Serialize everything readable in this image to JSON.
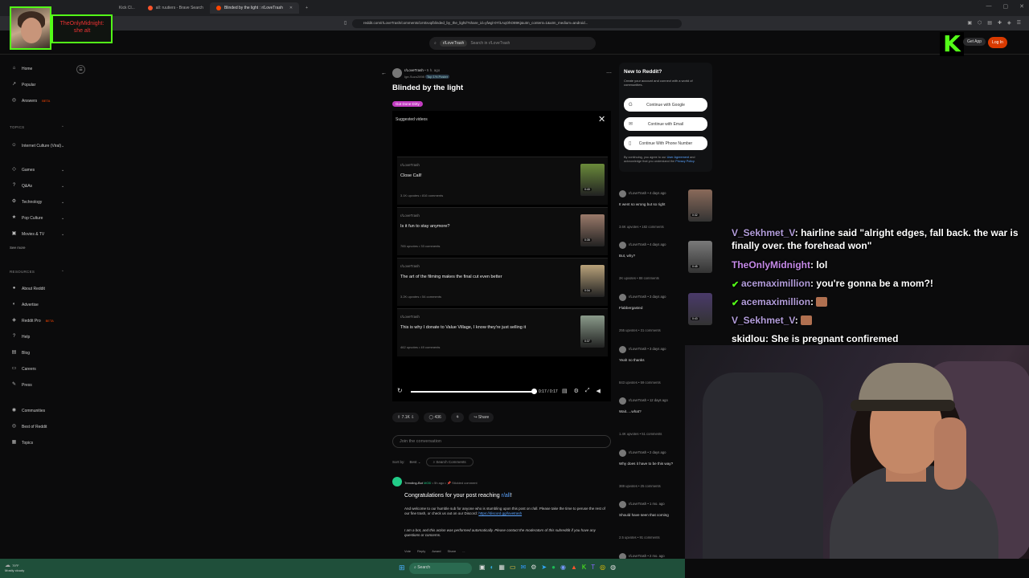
{
  "browser": {
    "tabs": [
      {
        "label": "Kick Cl..."
      },
      {
        "label": "all: ruutiers - Brave Search"
      },
      {
        "label": "Blinded by the light : r/LoveTrash",
        "active": true
      }
    ],
    "url": "reddit.com/r/LoveTrash/comments/1m0xvq/blinded_by_the_light/?share_id=yfwgl-0Yl1AqOhO89Kj&utm_content=1&utm_medium=android..."
  },
  "streamer_cam": {
    "name": "TheOnlyMidnight: she alt"
  },
  "header": {
    "search_chip": "r/LoveTrash",
    "search_placeholder": "Search in r/LoveTrash",
    "get_app": "Get App",
    "login": "Log In",
    "kick_logo": "K"
  },
  "sidebar": {
    "items_top": [
      {
        "label": "Home",
        "icon": "home-icon",
        "glyph": "⌂"
      },
      {
        "label": "Popular",
        "icon": "popular-icon",
        "glyph": "↗"
      },
      {
        "label": "Answers",
        "icon": "answers-icon",
        "glyph": "◎",
        "badge": "BETA"
      }
    ],
    "topics_head": "TOPICS",
    "topics": [
      {
        "label": "Internet Culture (Viral)",
        "glyph": "☺"
      },
      {
        "label": "Games",
        "glyph": "◇"
      },
      {
        "label": "Q&As",
        "glyph": "?"
      },
      {
        "label": "Technology",
        "glyph": "⚙"
      },
      {
        "label": "Pop Culture",
        "glyph": "★"
      },
      {
        "label": "Movies & TV",
        "glyph": "▣"
      }
    ],
    "see_more": "See more",
    "resources_head": "RESOURCES",
    "resources": [
      {
        "label": "About Reddit",
        "glyph": "●"
      },
      {
        "label": "Advertise",
        "glyph": "◐"
      },
      {
        "label": "Reddit Pro",
        "glyph": "◈",
        "badge": "BETA"
      },
      {
        "label": "Help",
        "glyph": "?"
      },
      {
        "label": "Blog",
        "glyph": "▤"
      },
      {
        "label": "Careers",
        "glyph": "▭"
      },
      {
        "label": "Press",
        "glyph": "✎"
      }
    ],
    "bottom": [
      {
        "label": "Communities",
        "glyph": "◉"
      },
      {
        "label": "Best of Reddit",
        "glyph": "◎"
      },
      {
        "label": "Topics",
        "glyph": "▦"
      }
    ]
  },
  "post": {
    "subreddit": "r/LoveTrash",
    "time": "• 5 h. ago",
    "username": "Ige-Suzo2898",
    "user_flair": "Top 1% Poster",
    "title": "Blinded by the light",
    "flair": "Got Done Dirty"
  },
  "video": {
    "label": "Suggested videos",
    "suggestions": [
      {
        "sub": "r/LoveTrash",
        "title": "Close Call!",
        "meta": "3.1K upvotes • 816 comments",
        "duration": "0:40",
        "color": "#6a8a3a"
      },
      {
        "sub": "r/LoveTrash",
        "title": "Is it fun to stay anymore?",
        "meta": "765 upvotes • 33 comments",
        "duration": "0:35",
        "color": "#9a7a6a"
      },
      {
        "sub": "r/LoveTrash",
        "title": "The art of the filming makes the final cut even better",
        "meta": "3.2K upvotes • 54 comments",
        "duration": "0:34",
        "color": "#b9a27a"
      },
      {
        "sub": "r/LoveTrash",
        "title": "This is why I donate to Value Village, I know they're just selling it",
        "meta": "462 upvotes • 49 comments",
        "duration": "0:37",
        "color": "#8a9a8a"
      }
    ],
    "time": "0:17 / 0:17",
    "progress": 1.0
  },
  "actions": {
    "votes": "7.1K",
    "comments": "436",
    "share": "Share"
  },
  "join": "Join the conversation",
  "sort": {
    "label": "Sort by:",
    "value": "Best",
    "search": "Search Comments"
  },
  "comment": {
    "user": "Trending-Bot",
    "mod": "MOD",
    "time": "• 5h ago •",
    "pinned": "Stickied comment",
    "title_pre": "Congratulations for your post reaching",
    "title_link": "r/all",
    "title_post": "!",
    "body": "And welcome to our humble sub for anyone who is stumbling upon this post on r/all. Please take the time to peruse the rest of our fine trash, or check us out on our Discord:",
    "body_link": "https://discord.gg/lovetrash",
    "bot": "I am a bot, and this action was performed automatically. Please",
    "bot_link": "contact the moderators of this subreddit",
    "bot_end": "if you have any questions or concerns.",
    "acts": [
      "Vote",
      "Reply",
      "Award",
      "Share",
      "..."
    ]
  },
  "newto": {
    "title": "New to Reddit?",
    "desc": "Create your account and connect with a world of communities.",
    "buttons": [
      "Continue with Google",
      "Continue with Email",
      "Continue With Phone Number"
    ],
    "terms_pre": "By continuing, you agree to our",
    "terms_link": "User Agreement",
    "terms_mid": "and acknowledge that you understand the",
    "privacy_link": "Privacy Policy"
  },
  "related": [
    {
      "sub": "r/LoveTrash • 4 days ago",
      "title": "It went so wrong but so right",
      "meta": "3.6K upvotes • 182 comments",
      "duration": "0:32",
      "color": "#8a6a5a"
    },
    {
      "sub": "r/LoveTrash • 4 days ago",
      "title": "But, why?",
      "meta": "2K upvotes • 88 comments",
      "duration": "0:45",
      "color": "#7a7a7a"
    },
    {
      "sub": "r/LoveTrash • 3 days ago",
      "title": "Flabbergasted",
      "meta": "255 upvotes • 31 comments",
      "duration": "0:43",
      "color": "#4a3a6a"
    },
    {
      "sub": "r/LoveTrash • 3 days ago",
      "title": "Yeah no thanks",
      "meta": "843 upvotes • 59 comments",
      "duration": "",
      "color": ""
    },
    {
      "sub": "r/LoveTrash • 12 days ago",
      "title": "Wait.....what?",
      "meta": "1.4K upvotes • 51 comments",
      "duration": "",
      "color": ""
    },
    {
      "sub": "r/LoveTrash • 2 days ago",
      "title": "Why does it have to be this way?",
      "meta": "369 upvotes • 25 comments",
      "duration": "",
      "color": ""
    },
    {
      "sub": "r/LoveTrash • 1 mo. ago",
      "title": "Should have seen that coming",
      "meta": "2.5 upvotes • 91 comments",
      "duration": "",
      "color": ""
    },
    {
      "sub": "r/LoveTrash • 2 mo. ago",
      "title": "",
      "meta": "",
      "duration": "",
      "color": ""
    }
  ],
  "chat": [
    {
      "user": "V_Sekhmet_V",
      "color": "#b39ddb",
      "text": "hairline said \"alright edges, fall back. the war is finally over. the forehead won\"",
      "badge": false,
      "emote": false
    },
    {
      "user": "TheOnlyMidnight",
      "color": "#c589e8",
      "text": "lol",
      "badge": false,
      "emote": false
    },
    {
      "user": "acemaximillion",
      "color": "#b39ddb",
      "text": "you're gonna be a mom?!",
      "badge": true,
      "emote": false
    },
    {
      "user": "acemaximillion",
      "color": "#b39ddb",
      "text": "",
      "badge": true,
      "emote": true
    },
    {
      "user": "V_Sekhmet_V",
      "color": "#b39ddb",
      "text": "",
      "badge": false,
      "emote": true
    },
    {
      "user": "skidlou",
      "color": "#ffffff",
      "text": "She is pregnant confiremed",
      "badge": false,
      "emote": false
    }
  ],
  "taskbar": {
    "weather_temp": "79°F",
    "weather_desc": "Mostly cloudy",
    "search": "Search"
  }
}
